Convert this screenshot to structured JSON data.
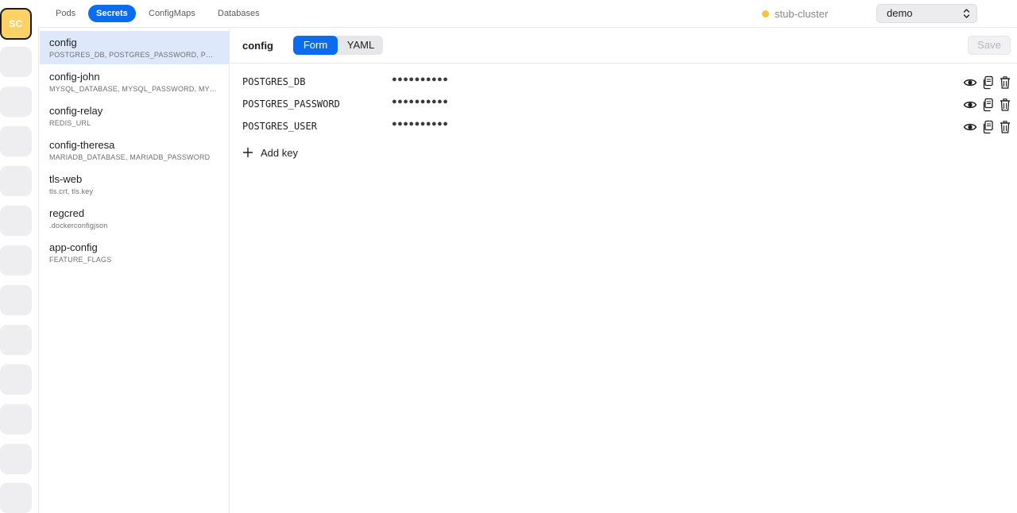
{
  "rail": {
    "avatar_initials": "SC",
    "slot_count": 12
  },
  "nav": {
    "tabs": [
      {
        "label": "Pods",
        "active": false
      },
      {
        "label": "Secrets",
        "active": true
      },
      {
        "label": "ConfigMaps",
        "active": false
      },
      {
        "label": "Databases",
        "active": false
      }
    ]
  },
  "cluster": {
    "name": "stub-cluster",
    "status_color": "#f7c23f"
  },
  "namespace": {
    "selected": "demo"
  },
  "secrets": [
    {
      "name": "config",
      "keys": "POSTGRES_DB, POSTGRES_PASSWORD, POSTGRES_USER",
      "selected": true
    },
    {
      "name": "config-john",
      "keys": "MYSQL_DATABASE, MYSQL_PASSWORD, MYSQL_USER"
    },
    {
      "name": "config-relay",
      "keys": "REDIS_URL"
    },
    {
      "name": "config-theresa",
      "keys": "MARIADB_DATABASE, MARIADB_PASSWORD"
    },
    {
      "name": "tls-web",
      "keys": "tls.crt, tls.key"
    },
    {
      "name": "regcred",
      "keys": ".dockerconfigjson"
    },
    {
      "name": "app-config",
      "keys": "FEATURE_FLAGS"
    }
  ],
  "detail": {
    "title": "config",
    "view_modes": [
      {
        "label": "Form",
        "active": true
      },
      {
        "label": "YAML",
        "active": false
      }
    ],
    "save_label": "Save",
    "entries": [
      {
        "key": "POSTGRES_DB",
        "masked_value": "●●●●●●●●●●"
      },
      {
        "key": "POSTGRES_PASSWORD",
        "masked_value": "●●●●●●●●●●"
      },
      {
        "key": "POSTGRES_USER",
        "masked_value": "●●●●●●●●●●"
      }
    ],
    "add_key_label": "Add key",
    "row_icons": [
      "eye-icon",
      "copy-icon",
      "trash-icon"
    ]
  },
  "colors": {
    "accent": "#0a6cf1",
    "selected_row": "#dde9fb",
    "avatar": "#fcd267"
  }
}
